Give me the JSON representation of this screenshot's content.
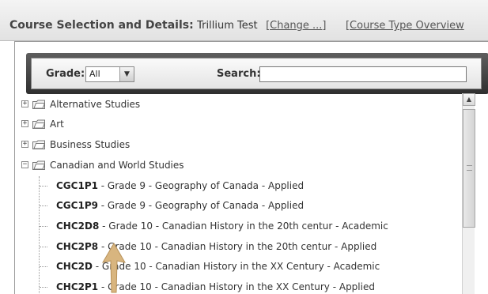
{
  "header": {
    "title": "Course Selection and Details:",
    "course_name": "Trillium Test",
    "change_link": "[Change ...]",
    "overview_link": "[Course Type Overview"
  },
  "filter": {
    "grade_label": "Grade:",
    "grade_value": "All",
    "search_label": "Search:",
    "search_value": ""
  },
  "tree": {
    "categories": [
      {
        "label": "Alternative Studies",
        "state": "collapsed"
      },
      {
        "label": "Art",
        "state": "collapsed"
      },
      {
        "label": "Business Studies",
        "state": "collapsed"
      },
      {
        "label": "Canadian and World Studies",
        "state": "expanded"
      }
    ],
    "courses": [
      {
        "code": "CGC1P1",
        "desc": " - Grade 9 - Geography of Canada - Applied"
      },
      {
        "code": "CGC1P9",
        "desc": " - Grade 9 - Geography of Canada - Applied"
      },
      {
        "code": "CHC2D8",
        "desc": " - Grade 10 - Canadian History in the 20th centur - Academic"
      },
      {
        "code": "CHC2P8",
        "desc": " - Grade 10 - Canadian History in the 20th centur - Applied"
      },
      {
        "code": "CHC2D",
        "desc": " - Grade 10 - Canadian History in the XX Century - Academic"
      },
      {
        "code": "CHC2P1",
        "desc": " - Grade 10 - Canadian History in the XX Century - Applied"
      }
    ]
  },
  "icons": {
    "expand": "plus-box-icon",
    "collapse": "minus-box-icon",
    "folder": "folder-icon",
    "scroll_up": "scroll-up-arrow-icon",
    "pointer": "arrow-pointer-icon"
  },
  "colors": {
    "filter_bar": "#3c3c3c",
    "pointer": "#d4b07a"
  }
}
